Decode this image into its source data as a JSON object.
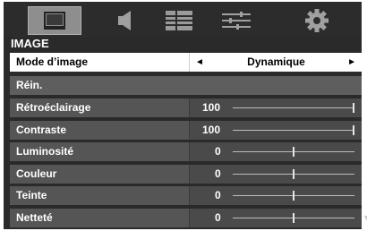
{
  "colors": {
    "background": "#2a2a2a",
    "row": "#555555",
    "selected_row": "#ffffff",
    "active_tab": "#8e8e8e"
  },
  "tabs": [
    {
      "icon": "picture-icon",
      "active": true
    },
    {
      "icon": "speaker-icon",
      "active": false
    },
    {
      "icon": "menu-lines-icon",
      "active": false
    },
    {
      "icon": "adjust-sliders-icon",
      "active": false
    },
    {
      "icon": "gear-icon",
      "active": false
    }
  ],
  "section": {
    "title": "IMAGE"
  },
  "menu": {
    "picture_mode": {
      "label": "Mode d’image",
      "value": "Dynamique",
      "left_arrow": "◄",
      "right_arrow": "►"
    },
    "reset": {
      "label": "Réin."
    },
    "items": [
      {
        "label": "Rétroéclairage",
        "value": "100",
        "level": 1.0
      },
      {
        "label": "Contraste",
        "value": "100",
        "level": 1.0
      },
      {
        "label": "Luminosité",
        "value": "0",
        "level": 0.5
      },
      {
        "label": "Couleur",
        "value": "0",
        "level": 0.5
      },
      {
        "label": "Teinte",
        "value": "0",
        "level": 0.5
      },
      {
        "label": "Netteté",
        "value": "0",
        "level": 0.5
      }
    ]
  }
}
